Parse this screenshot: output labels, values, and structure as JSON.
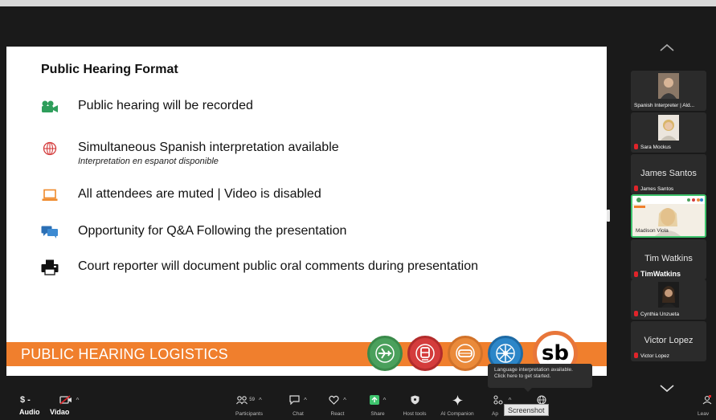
{
  "slide": {
    "title": "Public Hearing Format",
    "bullets": [
      {
        "icon": "video-camera-icon",
        "text": "Public hearing will be recorded"
      },
      {
        "icon": "globe-icon",
        "text": "Simultaneous Spanish interpretation available",
        "sub": "Interpretation en espanot disponible"
      },
      {
        "icon": "laptop-icon",
        "text": "All attendees are muted | Video is disabled"
      },
      {
        "icon": "chat-bubbles-icon",
        "text": "Opportunity for Q&A Following the presentation"
      },
      {
        "icon": "printer-icon",
        "text": "Court reporter will document public oral comments during presentation"
      }
    ],
    "banner": "PUBLIC HEARING LOGISTICS",
    "logo_text": "sb",
    "colors": {
      "banner": "#f07f2d",
      "green": "#4aa05c",
      "red": "#d43c3c",
      "orange": "#ea8a3a",
      "blue": "#2c86c8"
    }
  },
  "participants": [
    {
      "name": "Spanish Interpreter | Ald...",
      "display": "",
      "video": true
    },
    {
      "name": "Sara Mockus",
      "display": "",
      "video": true
    },
    {
      "name": "James Santos",
      "display": "James Santos",
      "video": false
    },
    {
      "name": "Madison Viola",
      "display": "",
      "video": true,
      "active": true
    },
    {
      "name": "TimWatkins",
      "display": "Tim Watkins",
      "video": false
    },
    {
      "name": "Cynthia Unzueta",
      "display": "",
      "video": true
    },
    {
      "name": "Victor Lopez",
      "display": "Victor Lopez",
      "video": false
    }
  ],
  "toolbar": {
    "audio": "Audio",
    "audio_icon": "$ -",
    "video": "Vidao",
    "participants": "Participants",
    "participants_count": "59",
    "chat": "Chat",
    "react": "React",
    "share": "Share",
    "host_tools": "Host tools",
    "ai_companion": "AI Companion",
    "apps": "Ap",
    "leave": "Leav"
  },
  "tooltip": {
    "line1": "Language interpretation available.",
    "line2": "Click here to get started."
  },
  "screenshot_label": "Screenshot"
}
